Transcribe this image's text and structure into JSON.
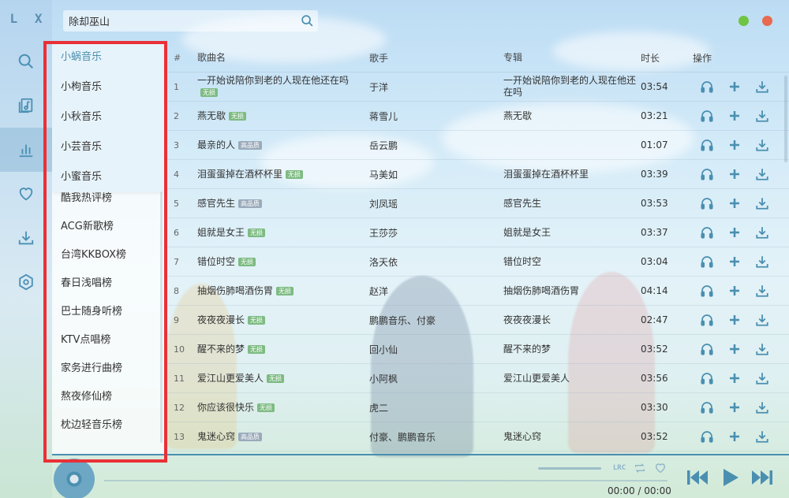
{
  "app": {
    "logo": "L X"
  },
  "search": {
    "value": "除却巫山"
  },
  "sources": [
    {
      "label": "小蜗音乐",
      "active": true
    },
    {
      "label": "小枸音乐"
    },
    {
      "label": "小秋音乐"
    },
    {
      "label": "小芸音乐"
    },
    {
      "label": "小蜜音乐"
    }
  ],
  "boards": [
    "酷我热评榜",
    "ACG新歌榜",
    "台湾KKBOX榜",
    "春日浅唱榜",
    "巴士随身听榜",
    "KTV点唱榜",
    "家务进行曲榜",
    "熬夜修仙榜",
    "枕边轻音乐榜"
  ],
  "columns": {
    "idx": "#",
    "name": "歌曲名",
    "singer": "歌手",
    "album": "专辑",
    "time": "时长",
    "ops": "操作"
  },
  "songs": [
    {
      "idx": "1",
      "name": "一开始说陪你到老的人现在他还在吗",
      "badge": "无损",
      "singer": "于洋",
      "album": "一开始说陪你到老的人现在他还在吗",
      "time": "03:54"
    },
    {
      "idx": "2",
      "name": "燕无歇",
      "badge": "无损",
      "singer": "蒋雪儿",
      "album": "燕无歇",
      "time": "03:21"
    },
    {
      "idx": "3",
      "name": "最亲的人",
      "badge": "高品质",
      "singer": "岳云鹏",
      "album": "",
      "time": "01:07"
    },
    {
      "idx": "4",
      "name": "泪蛋蛋掉在酒杯杯里",
      "badge": "无损",
      "singer": "马美如",
      "album": "泪蛋蛋掉在酒杯杯里",
      "time": "03:39"
    },
    {
      "idx": "5",
      "name": "感官先生",
      "badge": "高品质",
      "singer": "刘凤瑶",
      "album": "感官先生",
      "time": "03:53"
    },
    {
      "idx": "6",
      "name": "姐就是女王",
      "badge": "无损",
      "singer": "王莎莎",
      "album": "姐就是女王",
      "time": "03:37"
    },
    {
      "idx": "7",
      "name": "错位时空",
      "badge": "无损",
      "singer": "洛天依",
      "album": "错位时空",
      "time": "03:04"
    },
    {
      "idx": "8",
      "name": "抽烟伤肺喝酒伤胃",
      "badge": "无损",
      "singer": "赵洋",
      "album": "抽烟伤肺喝酒伤胃",
      "time": "04:14"
    },
    {
      "idx": "9",
      "name": "夜夜夜漫长",
      "badge": "无损",
      "singer": "鹏鹏音乐、付豪",
      "album": "夜夜夜漫长",
      "time": "02:47"
    },
    {
      "idx": "10",
      "name": "醒不来的梦",
      "badge": "无损",
      "singer": "回小仙",
      "album": "醒不来的梦",
      "time": "03:52"
    },
    {
      "idx": "11",
      "name": "爱江山更爱美人",
      "badge": "无损",
      "singer": "小阿枫",
      "album": "爱江山更爱美人",
      "time": "03:56"
    },
    {
      "idx": "12",
      "name": "你应该很快乐",
      "badge": "无损",
      "singer": "虎二",
      "album": "",
      "time": "03:30"
    },
    {
      "idx": "13",
      "name": "鬼迷心窍",
      "badge": "高品质",
      "singer": "付豪、鹏鹏音乐",
      "album": "鬼迷心窍",
      "time": "03:52"
    }
  ],
  "player": {
    "lrc_label": "LRC",
    "time": "00:00 / 00:00"
  },
  "colors": {
    "accent": "#4a8fb0",
    "lossless_badge": "#7dbb82",
    "hq_badge": "#9aaaba",
    "highlight_box": "#ea3037",
    "min_dot": "#6fc442",
    "close_dot": "#e86a4f"
  }
}
